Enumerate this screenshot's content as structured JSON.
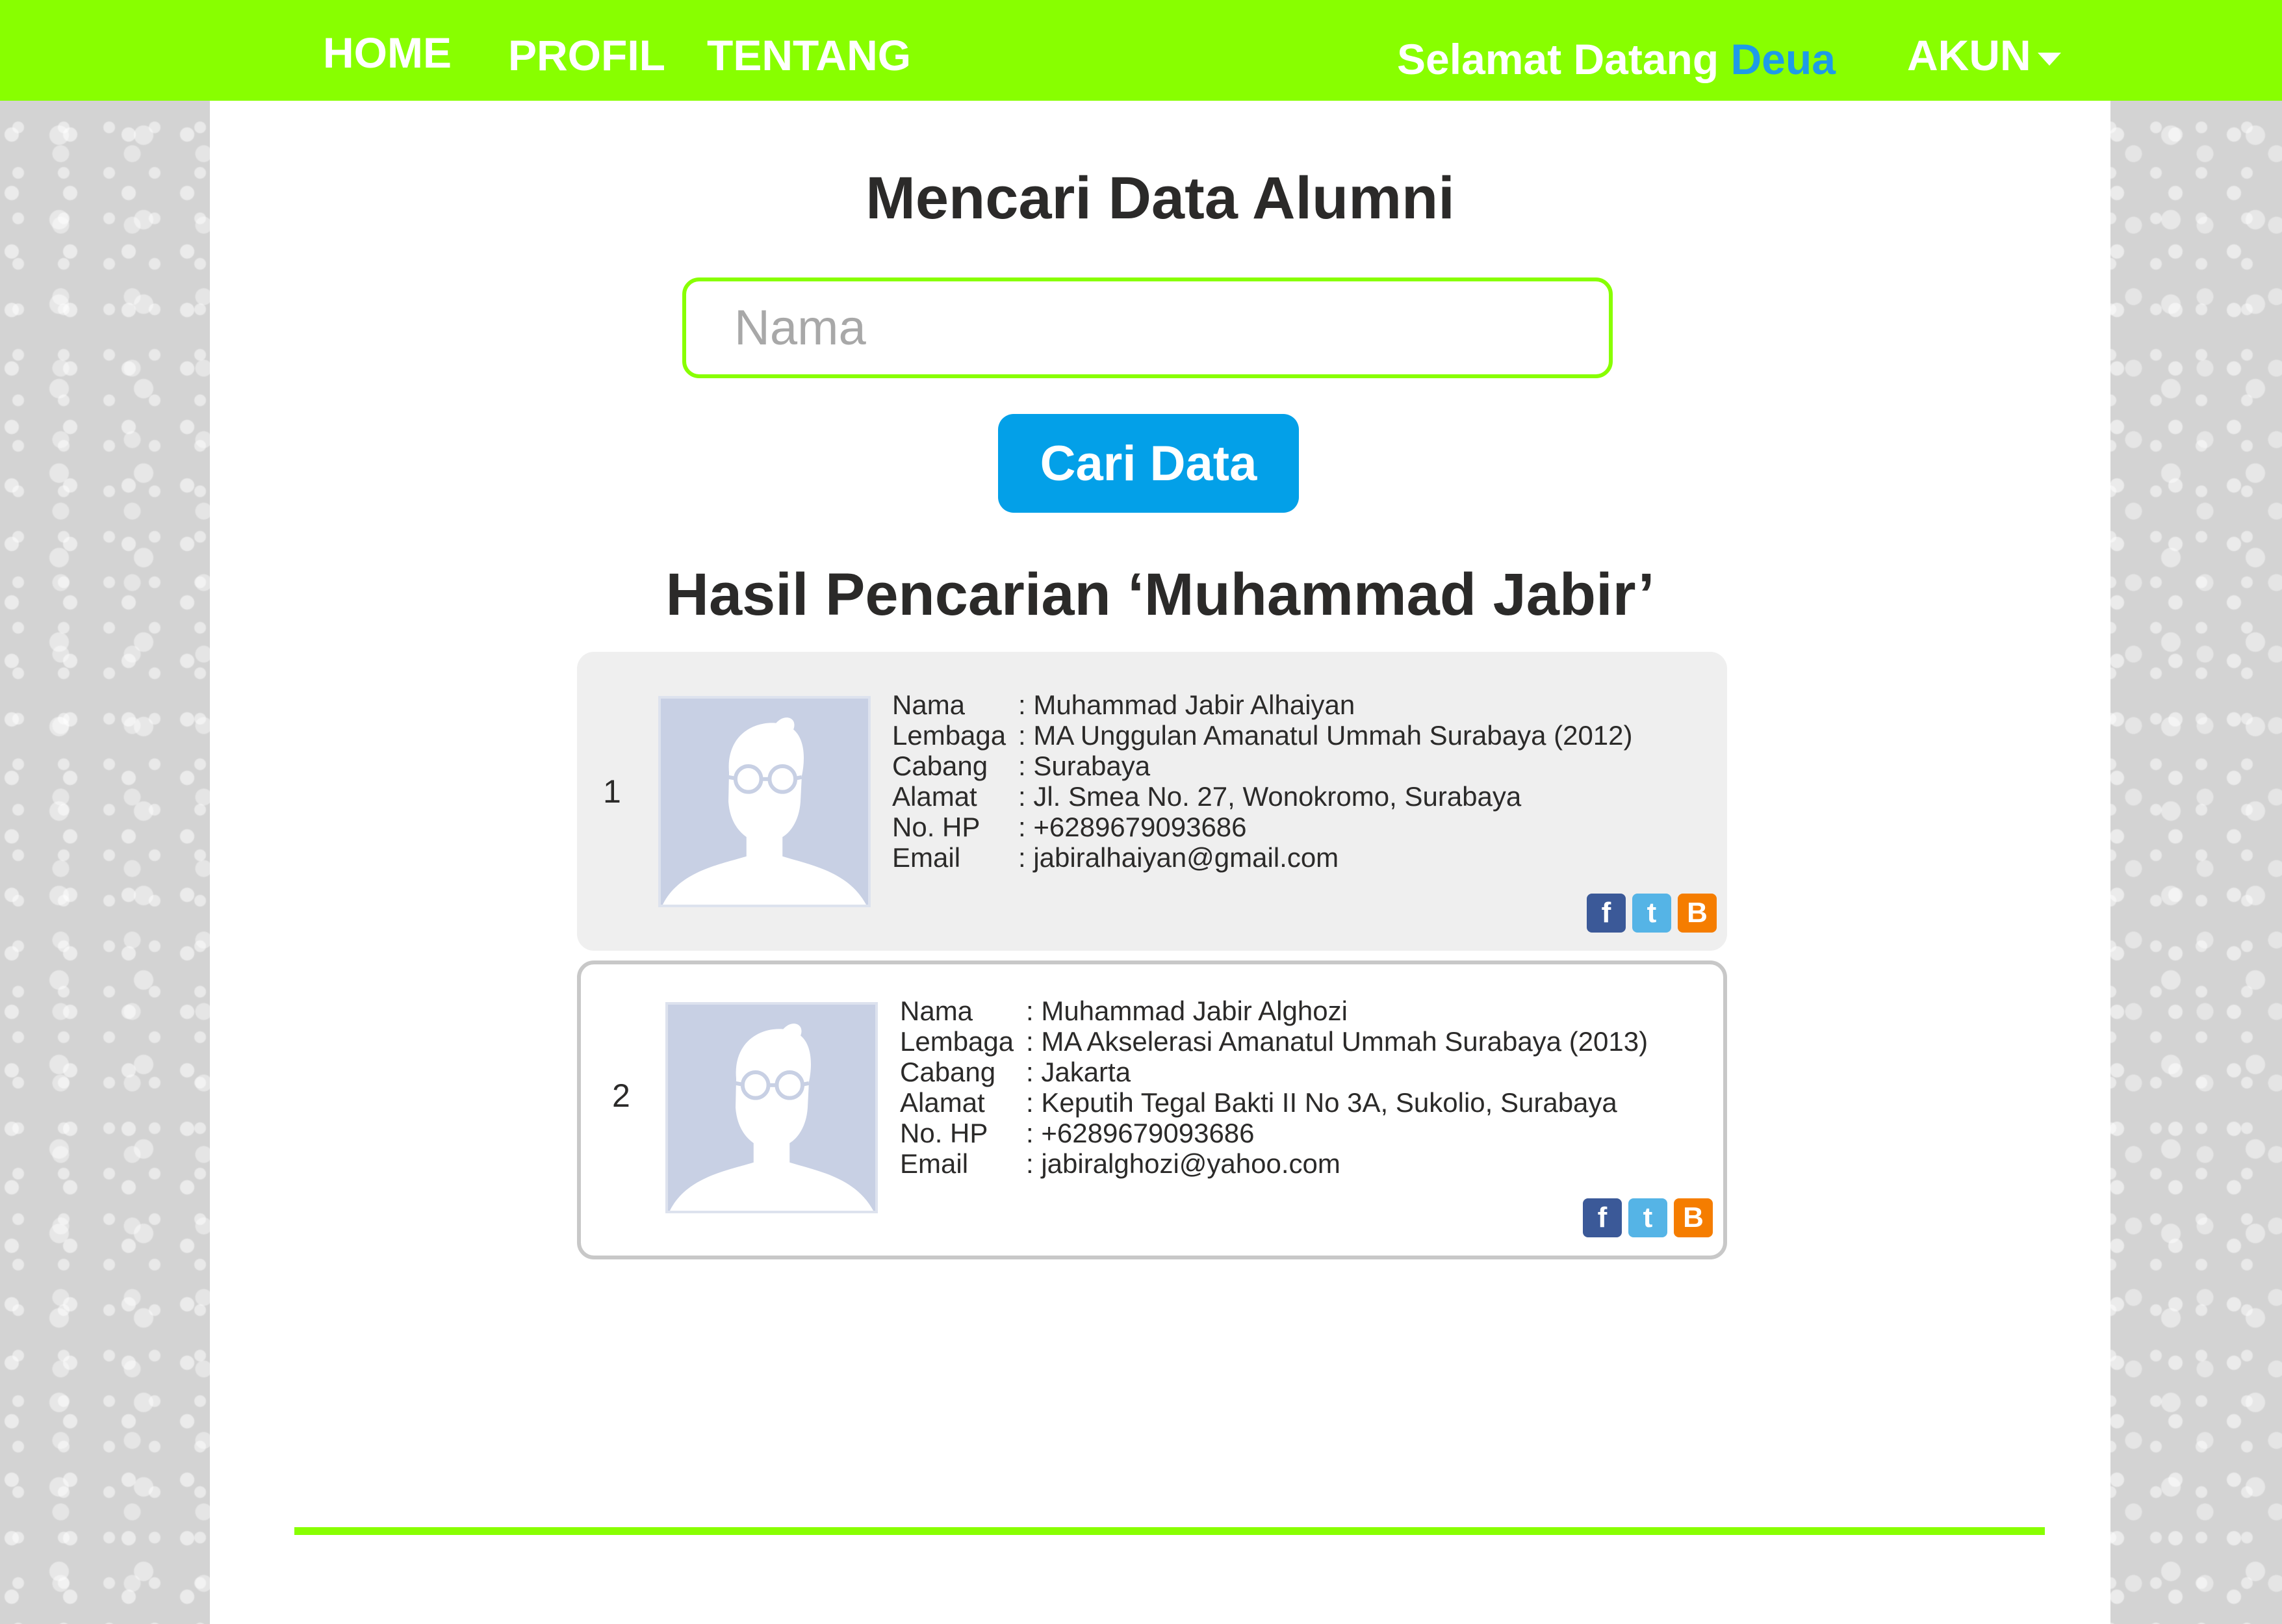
{
  "nav": {
    "home": "HOME",
    "profil": "PROFIL",
    "tentang": "TENTANG",
    "welcome_text": "Selamat Datang",
    "username": "Deua",
    "account": "AKUN"
  },
  "search": {
    "title": "Mencari Data Alumni",
    "placeholder": "Nama",
    "button": "Cari Data"
  },
  "results": {
    "heading": "Hasil Pencarian ‘Muhammad Jabir’",
    "labels": {
      "nama": "Nama",
      "lembaga": "Lembaga",
      "cabang": "Cabang",
      "alamat": "Alamat",
      "hp": "No. HP",
      "email": "Email"
    },
    "items": [
      {
        "no": "1",
        "nama": ": Muhammad Jabir Alhaiyan",
        "lembaga": ": MA Unggulan Amanatul Ummah Surabaya (2012)",
        "cabang": ": Surabaya",
        "alamat": ": Jl. Smea No. 27, Wonokromo, Surabaya",
        "hp": ": +6289679093686",
        "email": ": jabiralhaiyan@gmail.com"
      },
      {
        "no": "2",
        "nama": ": Muhammad Jabir Alghozi",
        "lembaga": ": MA Akselerasi Amanatul Ummah Surabaya (2013)",
        "cabang": ": Jakarta",
        "alamat": ": Keputih Tegal Bakti II No 3A, Sukolio, Surabaya",
        "hp": ": +6289679093686",
        "email": ": jabiralghozi@yahoo.com"
      }
    ],
    "social_icons": [
      "facebook-icon",
      "twitter-icon",
      "blogger-icon"
    ]
  },
  "colors": {
    "nav_bg": "#88ff00",
    "accent_blue": "#03a0e8",
    "username": "#1e9be8",
    "card_bg": "#efefef"
  }
}
